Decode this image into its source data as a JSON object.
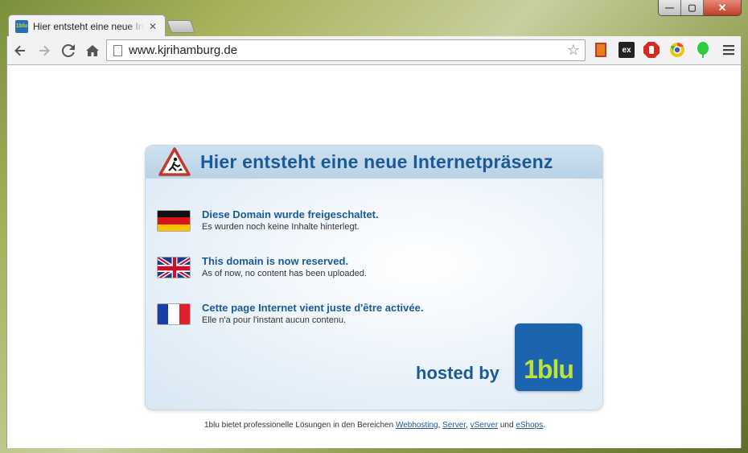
{
  "browser": {
    "tab": {
      "title": "Hier entsteht eine neue Internetpräsenz",
      "favicon_text": "1blu"
    },
    "controls": {
      "minimize": "—",
      "maximize": "▢",
      "close": "✕"
    },
    "address": {
      "url": "www.kjrihamburg.de"
    },
    "extensions": [
      "bookmark-icon",
      "ex-icon",
      "adblock-icon",
      "chrome-icon",
      "evernote-icon"
    ],
    "ext_ex_label": "ex"
  },
  "page": {
    "title": "Hier entsteht eine neue Internetpräsenz",
    "languages": [
      {
        "title": "Diese Domain wurde freigeschaltet.",
        "subtitle": "Es wurden noch keine Inhalte hinterlegt."
      },
      {
        "title": "This domain is now reserved.",
        "subtitle": "As of now, no content has been uploaded."
      },
      {
        "title": "Cette page Internet vient juste d'être activée.",
        "subtitle": "Elle n'a pour l'instant aucun contenu."
      }
    ],
    "hosted_by": "hosted by",
    "logo_text": "1blu",
    "footer": {
      "prefix": "1blu bietet professionelle Lösungen in den Bereichen",
      "link1": "Webhosting",
      "sep1": ",",
      "link2": "Server",
      "sep2": ",",
      "link3": "vServer",
      "and": "und",
      "link4": "eShops",
      "end": "."
    }
  },
  "colors": {
    "brand_blue": "#1b5a98",
    "logo_bg": "#1c64ad",
    "logo_fg": "#bde33a"
  }
}
